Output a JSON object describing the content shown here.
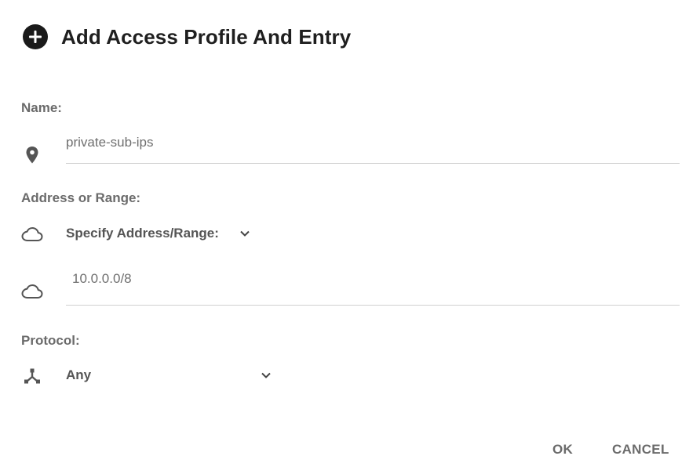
{
  "dialog": {
    "title": "Add Access Profile And Entry"
  },
  "name": {
    "label": "Name:",
    "value": "private-sub-ips",
    "icon": "location-pin-icon"
  },
  "address": {
    "label": "Address or Range:",
    "mode_value": "Specify Address/Range:",
    "mode_icon": "cloud-icon",
    "range_value": "10.0.0.0/8",
    "range_icon": "cloud-icon"
  },
  "protocol": {
    "label": "Protocol:",
    "value": "Any",
    "icon": "hub-icon"
  },
  "actions": {
    "ok_label": "OK",
    "cancel_label": "CANCEL"
  },
  "colors": {
    "title": "#1f1f1f",
    "label": "#6b6b6b",
    "icon": "#555555",
    "underline": "#cfcfcf"
  }
}
